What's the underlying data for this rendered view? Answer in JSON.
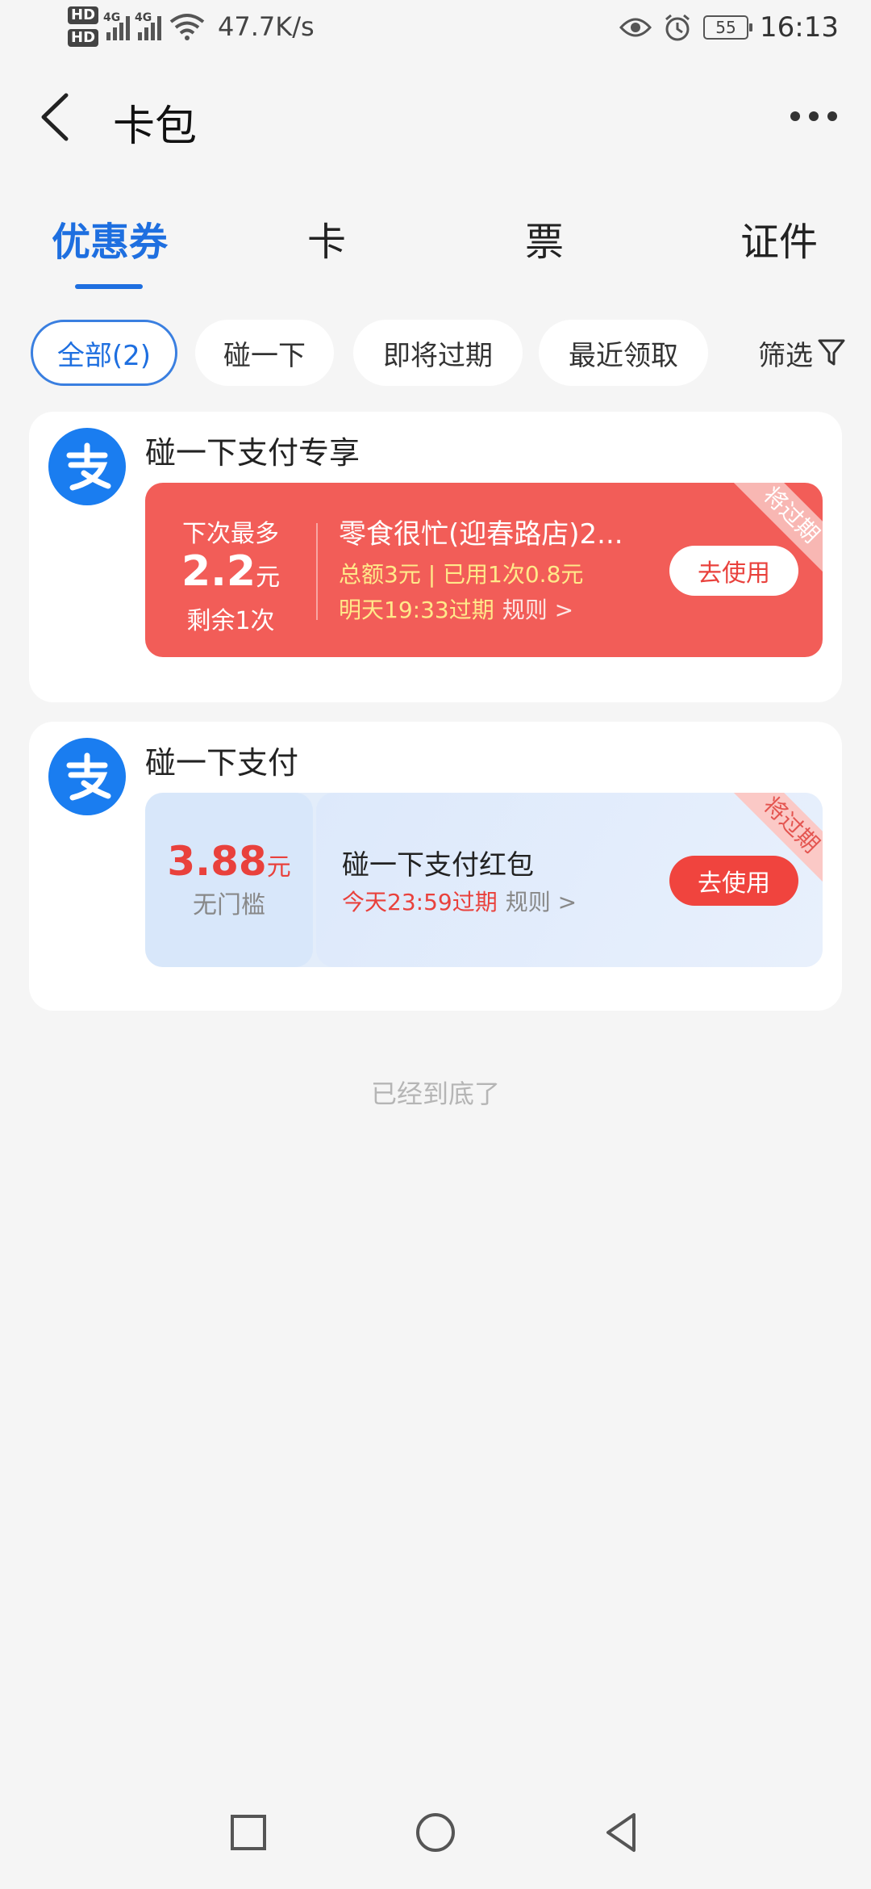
{
  "status_bar": {
    "hd1": "HD",
    "hd2": "HD",
    "net_tag": "4G",
    "speed": "47.7K/s",
    "battery": "55",
    "time": "16:13"
  },
  "nav": {
    "title": "卡包"
  },
  "tabs": [
    {
      "label": "优惠券"
    },
    {
      "label": "卡"
    },
    {
      "label": "票"
    },
    {
      "label": "证件"
    }
  ],
  "chips": [
    {
      "label": "全部(2)"
    },
    {
      "label": "碰一下"
    },
    {
      "label": "即将过期"
    },
    {
      "label": "最近领取"
    }
  ],
  "filter_label": "筛选",
  "cards": [
    {
      "title": "碰一下支付专享",
      "coupon": {
        "line1": "下次最多",
        "amount": "2.2",
        "unit": "元",
        "remain": "剩余1次",
        "name": "零食很忙(迎春路店)2...",
        "meta": "总额3元 | 已用1次0.8元",
        "expiry": "明天19:33过期",
        "rule": "规则 >",
        "button": "去使用",
        "ribbon": "将过期"
      }
    },
    {
      "title": "碰一下支付",
      "coupon": {
        "amount": "3.88",
        "unit": "元",
        "threshold": "无门槛",
        "name": "碰一下支付红包",
        "expiry": "今天23:59过期",
        "rule": "规则 >",
        "button": "去使用",
        "ribbon": "将过期"
      }
    }
  ],
  "end_text": "已经到底了",
  "colors": {
    "accent": "#1e6fe0",
    "coupon_red": "#f25d58",
    "button_red": "#f0443e",
    "alipay_blue": "#1a7df0"
  }
}
